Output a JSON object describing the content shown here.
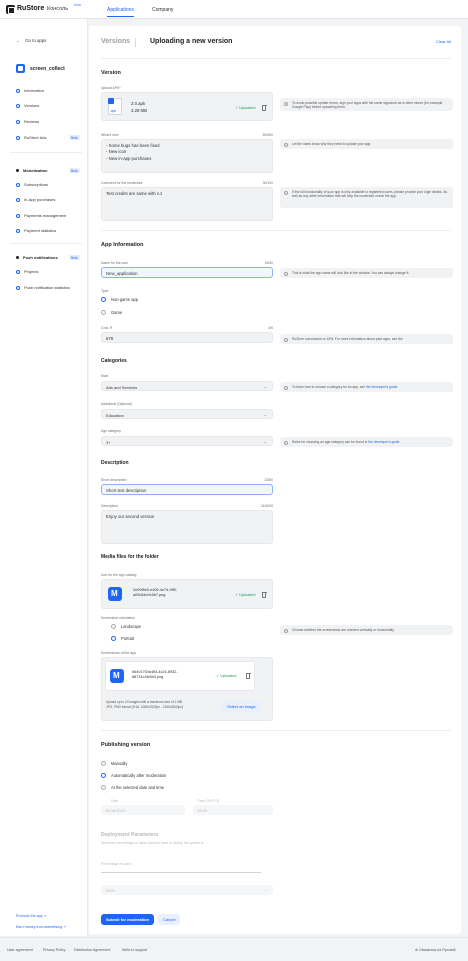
{
  "topbar": {
    "brand": "RuStore",
    "console": "Консоль",
    "beta": "beta",
    "tabs": [
      "Applications",
      "Company"
    ]
  },
  "sidebar": {
    "back": "Go to apps",
    "app_name": "screen_collect",
    "items": [
      "Information",
      "Versions",
      "Reviews",
      "RuStore Ads"
    ],
    "ads_badge": "Beta",
    "monetization": {
      "title": "Monetization",
      "badge": "Beta",
      "items": [
        "Subscriptions",
        "In-App purchases",
        "Payments management",
        "Payment statistics"
      ]
    },
    "push": {
      "title": "Push notifications",
      "badge": "Beta",
      "items": [
        "Projects",
        "Push notification statistics"
      ]
    },
    "promote": "Promote the app ↗",
    "earn": "Earn money from advertising ↗"
  },
  "header": {
    "versions": "Versions",
    "title": "Uploading a new version",
    "clear_all": "Clear All"
  },
  "version": {
    "title": "Version",
    "upload_label": "Upload APK*",
    "apk_name": "2.0.apk",
    "apk_size": "3.28 MB",
    "apk_ext": ".apk",
    "uploaded": "✓ Uploaded",
    "upload_hint": "To avoid possible update errors, sign your apps with the same signature as in other stores (for example, Google Play) before uploading them.",
    "whats_new_label": "What's new",
    "whats_new_count": "60/500",
    "whats_new_value": [
      "- Some bugs has been fixed",
      "- New icon",
      "- New in-app purchases"
    ],
    "whats_new_hint": "Let the users know why they need to update your app.",
    "comment_label": "Comment for the moderator",
    "comment_count": "30/100",
    "comment_value": "Test credits are same with v.1",
    "comment_hint": "If the full functionality of your app is only available to registered users, please provide your login details. As well as any other information that will help the moderator check the app."
  },
  "app_info": {
    "title": "App Information",
    "name_label": "Name for the user",
    "name_count": "15/50",
    "name_value": "New_application",
    "name_hint": "This is what the app name will look like in the window. You can always change it.",
    "type_label": "Type",
    "types": [
      "Non-game app",
      "Game"
    ],
    "price_label": "Cost, ₽",
    "price_count": "3/6",
    "price_value": "678",
    "price_hint": "RuStore commission is 15%. For more information about paid apps, see the",
    "categories_title": "Categories",
    "main_label": "Main",
    "main_value": "Ads and Services",
    "main_hint_pre": "To learn how to choose a category for an app, see",
    "main_hint_link": "the developer's guide",
    "additional_label": "Additional (Optional)",
    "additional_value": "Education",
    "age_label": "Age category",
    "age_value": "3+",
    "age_hint_pre": "Rules for choosing an age category can be found in",
    "age_hint_link": "the developer's guide",
    "desc_title": "Description",
    "short_label": "Short description",
    "short_count": "22/80",
    "short_value": "Short test description",
    "desc_label": "Description",
    "desc_count": "24/4000",
    "desc_value": "Enjoy our second version"
  },
  "media": {
    "title": "Media files for the folder",
    "icon_label": "Icon for the app catalog",
    "icon_file": [
      "2e90f8e0-e409-4e74-9ff5-",
      "a09c84e0c5b7.png"
    ],
    "uploaded": "✓ Uploaded",
    "orientation_label": "Screenshot orientation",
    "orientations": [
      "Landscape",
      "Portrait"
    ],
    "orientation_hint": "Choose whether the screenshots are oriented vertically or horizontally.",
    "screens_label": "Screenshots of the app",
    "screen_file": [
      "664017f2dc8f3-4c24-8932-",
      "88731c4fc5b3.png"
    ],
    "upload_info": [
      "Upload up to 10 images with a maximum size of 1 MB",
      "JPG, PNG format (9:16, 1080x1920px - 2160x3840px)"
    ],
    "select_image": "Select an image"
  },
  "publishing": {
    "title": "Publishing version",
    "options": [
      "Manually",
      "Automatically after moderation",
      "At the selected date and time"
    ],
    "date_label": "Date",
    "date_value": "15.08.2023",
    "time_label": "Time (GMT+3)",
    "time_value": "19:00",
    "deploy_title": "Deployment Parameters",
    "deploy_desc": "Select the percentage of users that you want to deploy the update to",
    "percentage_label": "Percentage of users",
    "percentage_value": "100%"
  },
  "actions": {
    "submit": "Submit for moderation",
    "cancel": "Cancel"
  },
  "footer": {
    "links": [
      "User agreement",
      "Privacy Policy",
      "Distribution Agreement",
      "Write to support"
    ],
    "lang": "Связаться на Русский"
  }
}
